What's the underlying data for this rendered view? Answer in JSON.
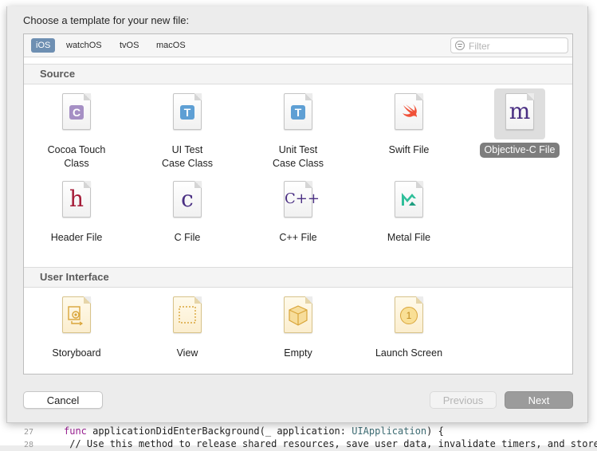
{
  "editor": {
    "lines": [
      {
        "num": "27",
        "pre": "func ",
        "name": "applicationDidEnterBackground(_ application: ",
        "type": "UIApplication",
        "post": ") {"
      },
      {
        "num": "28",
        "comment": "    // Use this method to release shared resources, save user data, invalidate timers, and store"
      }
    ]
  },
  "dialog": {
    "prompt": "Choose a template for your new file:",
    "platform_tabs": [
      {
        "label": "iOS",
        "selected": true
      },
      {
        "label": "watchOS",
        "selected": false
      },
      {
        "label": "tvOS",
        "selected": false
      },
      {
        "label": "macOS",
        "selected": false
      }
    ],
    "filter": {
      "placeholder": "Filter",
      "value": ""
    },
    "sections": [
      {
        "title": "Source",
        "templates": [
          {
            "label": "Cocoa Touch\nClass",
            "icon": "cocoa-touch-class-icon",
            "selected": false
          },
          {
            "label": "UI Test\nCase Class",
            "icon": "ui-test-case-class-icon",
            "selected": false
          },
          {
            "label": "Unit Test\nCase Class",
            "icon": "unit-test-case-class-icon",
            "selected": false
          },
          {
            "label": "Swift File",
            "icon": "swift-file-icon",
            "selected": false
          },
          {
            "label": "Objective-C File",
            "icon": "objective-c-file-icon",
            "selected": true
          },
          {
            "label": "Header File",
            "icon": "header-file-icon",
            "selected": false
          },
          {
            "label": "C File",
            "icon": "c-file-icon",
            "selected": false
          },
          {
            "label": "C++ File",
            "icon": "cpp-file-icon",
            "selected": false
          },
          {
            "label": "Metal File",
            "icon": "metal-file-icon",
            "selected": false
          }
        ]
      },
      {
        "title": "User Interface",
        "templates": [
          {
            "label": "Storyboard",
            "icon": "storyboard-icon",
            "selected": false
          },
          {
            "label": "View",
            "icon": "view-icon",
            "selected": false
          },
          {
            "label": "Empty",
            "icon": "empty-icon",
            "selected": false
          },
          {
            "label": "Launch Screen",
            "icon": "launch-screen-icon",
            "selected": false
          }
        ]
      }
    ],
    "icon_glyphs": {
      "cocoa": "C",
      "ui_test": "T",
      "unit_test": "T",
      "objc": "m",
      "header": "h",
      "c": "c",
      "cpp": "C++",
      "launch": "1"
    },
    "buttons": {
      "cancel": "Cancel",
      "previous": "Previous",
      "next": "Next"
    },
    "colors": {
      "selected_tab": "#6e8fb2",
      "selected_label": "#7d7d7d",
      "next_button": "#9b9b9b"
    }
  }
}
